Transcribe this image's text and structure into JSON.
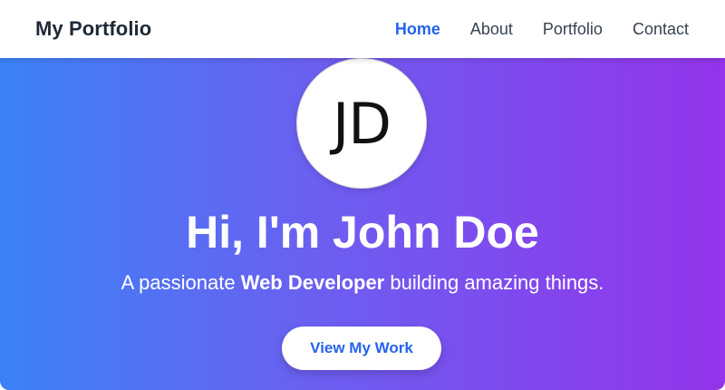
{
  "header": {
    "brand": "My Portfolio",
    "nav": [
      {
        "label": "Home",
        "active": true
      },
      {
        "label": "About",
        "active": false
      },
      {
        "label": "Portfolio",
        "active": false
      },
      {
        "label": "Contact",
        "active": false
      }
    ]
  },
  "hero": {
    "avatar_initials": "JD",
    "title": "Hi, I'm John Doe",
    "subtitle_prefix": "A passionate ",
    "subtitle_emphasis": "Web Developer",
    "subtitle_suffix": " building amazing things.",
    "cta_label": "View My Work"
  },
  "colors": {
    "accent": "#2563eb",
    "gradient_start": "#3b82f6",
    "gradient_end": "#9333ea",
    "brand_text": "#1f2937"
  }
}
